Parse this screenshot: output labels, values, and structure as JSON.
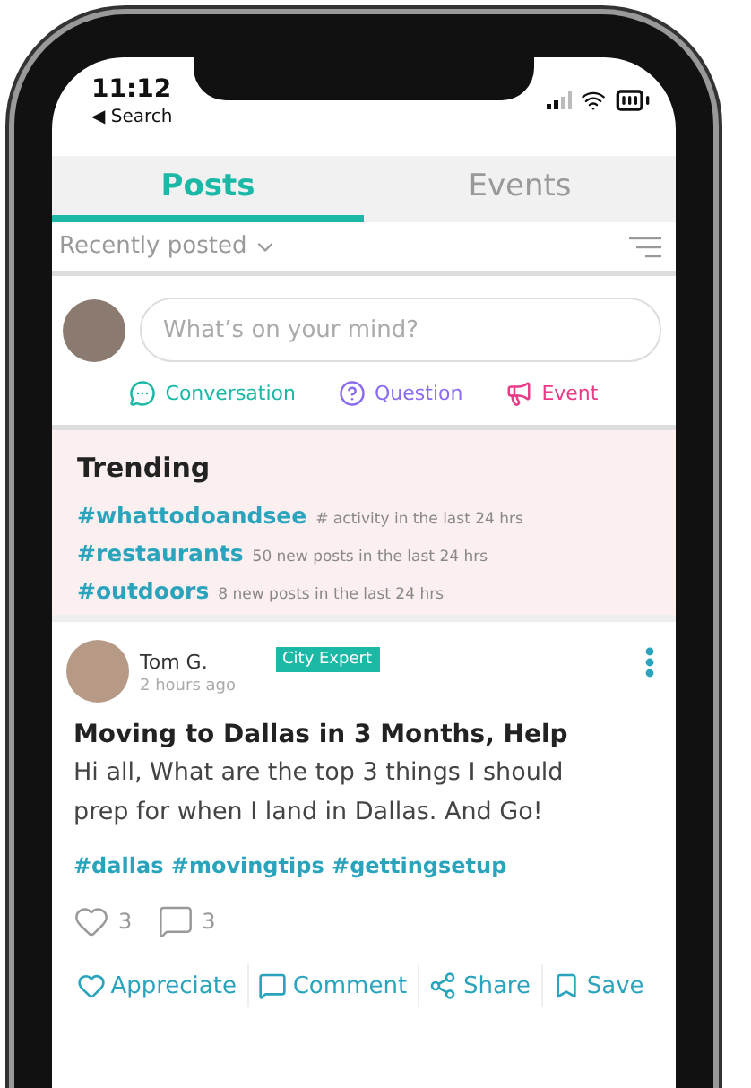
{
  "status_bar": {
    "time": "11:12",
    "back_label": "◀ Search"
  },
  "tabs": [
    {
      "label": "Posts",
      "selected": true
    },
    {
      "label": "Events",
      "selected": false
    }
  ],
  "sort": {
    "label": "Recently posted"
  },
  "composer": {
    "placeholder": "What’s on your mind?",
    "actions": [
      {
        "kind": "conversation",
        "label": "Conversation",
        "color": "#1bb8a6"
      },
      {
        "kind": "question",
        "label": "Question",
        "color": "#8b6cf0"
      },
      {
        "kind": "event",
        "label": "Event",
        "color": "#e93b87"
      }
    ]
  },
  "trending": {
    "title": "Trending",
    "items": [
      {
        "tag": "#whattodoandsee",
        "note": "# activity in the last 24 hrs"
      },
      {
        "tag": "#restaurants",
        "note": "50 new posts in the last 24 hrs"
      },
      {
        "tag": "#outdoors",
        "note": "8 new posts in the last 24 hrs"
      }
    ]
  },
  "post": {
    "author": "Tom G.",
    "badge": "City Expert",
    "time": "2 hours ago",
    "title": "Moving to Dallas in 3 Months, Help",
    "body": "Hi all, What are the top 3 things I should prep for when I land in Dallas. And Go!",
    "tags": "#dallas #movingtips #gettingsetup",
    "likes": "3",
    "comments": "3",
    "actions": [
      {
        "kind": "appreciate",
        "label": "Appreciate"
      },
      {
        "kind": "comment",
        "label": "Comment"
      },
      {
        "kind": "share",
        "label": "Share"
      },
      {
        "kind": "save",
        "label": "Save"
      }
    ]
  }
}
